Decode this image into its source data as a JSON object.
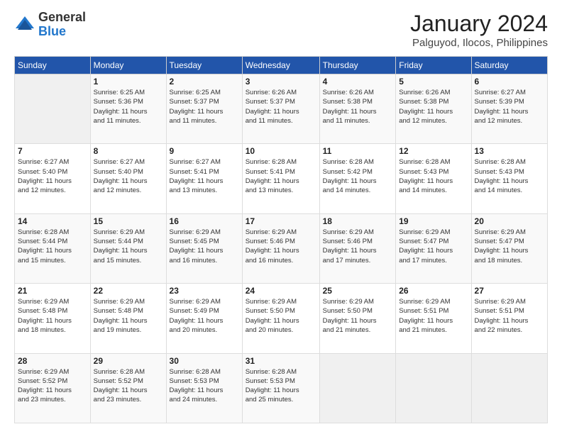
{
  "header": {
    "logo_general": "General",
    "logo_blue": "Blue",
    "month": "January 2024",
    "location": "Palguyod, Ilocos, Philippines"
  },
  "days_of_week": [
    "Sunday",
    "Monday",
    "Tuesday",
    "Wednesday",
    "Thursday",
    "Friday",
    "Saturday"
  ],
  "weeks": [
    [
      {
        "day": "",
        "info": ""
      },
      {
        "day": "1",
        "info": "Sunrise: 6:25 AM\nSunset: 5:36 PM\nDaylight: 11 hours\nand 11 minutes."
      },
      {
        "day": "2",
        "info": "Sunrise: 6:25 AM\nSunset: 5:37 PM\nDaylight: 11 hours\nand 11 minutes."
      },
      {
        "day": "3",
        "info": "Sunrise: 6:26 AM\nSunset: 5:37 PM\nDaylight: 11 hours\nand 11 minutes."
      },
      {
        "day": "4",
        "info": "Sunrise: 6:26 AM\nSunset: 5:38 PM\nDaylight: 11 hours\nand 11 minutes."
      },
      {
        "day": "5",
        "info": "Sunrise: 6:26 AM\nSunset: 5:38 PM\nDaylight: 11 hours\nand 12 minutes."
      },
      {
        "day": "6",
        "info": "Sunrise: 6:27 AM\nSunset: 5:39 PM\nDaylight: 11 hours\nand 12 minutes."
      }
    ],
    [
      {
        "day": "7",
        "info": "Sunrise: 6:27 AM\nSunset: 5:40 PM\nDaylight: 11 hours\nand 12 minutes."
      },
      {
        "day": "8",
        "info": "Sunrise: 6:27 AM\nSunset: 5:40 PM\nDaylight: 11 hours\nand 12 minutes."
      },
      {
        "day": "9",
        "info": "Sunrise: 6:27 AM\nSunset: 5:41 PM\nDaylight: 11 hours\nand 13 minutes."
      },
      {
        "day": "10",
        "info": "Sunrise: 6:28 AM\nSunset: 5:41 PM\nDaylight: 11 hours\nand 13 minutes."
      },
      {
        "day": "11",
        "info": "Sunrise: 6:28 AM\nSunset: 5:42 PM\nDaylight: 11 hours\nand 14 minutes."
      },
      {
        "day": "12",
        "info": "Sunrise: 6:28 AM\nSunset: 5:43 PM\nDaylight: 11 hours\nand 14 minutes."
      },
      {
        "day": "13",
        "info": "Sunrise: 6:28 AM\nSunset: 5:43 PM\nDaylight: 11 hours\nand 14 minutes."
      }
    ],
    [
      {
        "day": "14",
        "info": "Sunrise: 6:28 AM\nSunset: 5:44 PM\nDaylight: 11 hours\nand 15 minutes."
      },
      {
        "day": "15",
        "info": "Sunrise: 6:29 AM\nSunset: 5:44 PM\nDaylight: 11 hours\nand 15 minutes."
      },
      {
        "day": "16",
        "info": "Sunrise: 6:29 AM\nSunset: 5:45 PM\nDaylight: 11 hours\nand 16 minutes."
      },
      {
        "day": "17",
        "info": "Sunrise: 6:29 AM\nSunset: 5:46 PM\nDaylight: 11 hours\nand 16 minutes."
      },
      {
        "day": "18",
        "info": "Sunrise: 6:29 AM\nSunset: 5:46 PM\nDaylight: 11 hours\nand 17 minutes."
      },
      {
        "day": "19",
        "info": "Sunrise: 6:29 AM\nSunset: 5:47 PM\nDaylight: 11 hours\nand 17 minutes."
      },
      {
        "day": "20",
        "info": "Sunrise: 6:29 AM\nSunset: 5:47 PM\nDaylight: 11 hours\nand 18 minutes."
      }
    ],
    [
      {
        "day": "21",
        "info": "Sunrise: 6:29 AM\nSunset: 5:48 PM\nDaylight: 11 hours\nand 18 minutes."
      },
      {
        "day": "22",
        "info": "Sunrise: 6:29 AM\nSunset: 5:48 PM\nDaylight: 11 hours\nand 19 minutes."
      },
      {
        "day": "23",
        "info": "Sunrise: 6:29 AM\nSunset: 5:49 PM\nDaylight: 11 hours\nand 20 minutes."
      },
      {
        "day": "24",
        "info": "Sunrise: 6:29 AM\nSunset: 5:50 PM\nDaylight: 11 hours\nand 20 minutes."
      },
      {
        "day": "25",
        "info": "Sunrise: 6:29 AM\nSunset: 5:50 PM\nDaylight: 11 hours\nand 21 minutes."
      },
      {
        "day": "26",
        "info": "Sunrise: 6:29 AM\nSunset: 5:51 PM\nDaylight: 11 hours\nand 21 minutes."
      },
      {
        "day": "27",
        "info": "Sunrise: 6:29 AM\nSunset: 5:51 PM\nDaylight: 11 hours\nand 22 minutes."
      }
    ],
    [
      {
        "day": "28",
        "info": "Sunrise: 6:29 AM\nSunset: 5:52 PM\nDaylight: 11 hours\nand 23 minutes."
      },
      {
        "day": "29",
        "info": "Sunrise: 6:28 AM\nSunset: 5:52 PM\nDaylight: 11 hours\nand 23 minutes."
      },
      {
        "day": "30",
        "info": "Sunrise: 6:28 AM\nSunset: 5:53 PM\nDaylight: 11 hours\nand 24 minutes."
      },
      {
        "day": "31",
        "info": "Sunrise: 6:28 AM\nSunset: 5:53 PM\nDaylight: 11 hours\nand 25 minutes."
      },
      {
        "day": "",
        "info": ""
      },
      {
        "day": "",
        "info": ""
      },
      {
        "day": "",
        "info": ""
      }
    ]
  ]
}
